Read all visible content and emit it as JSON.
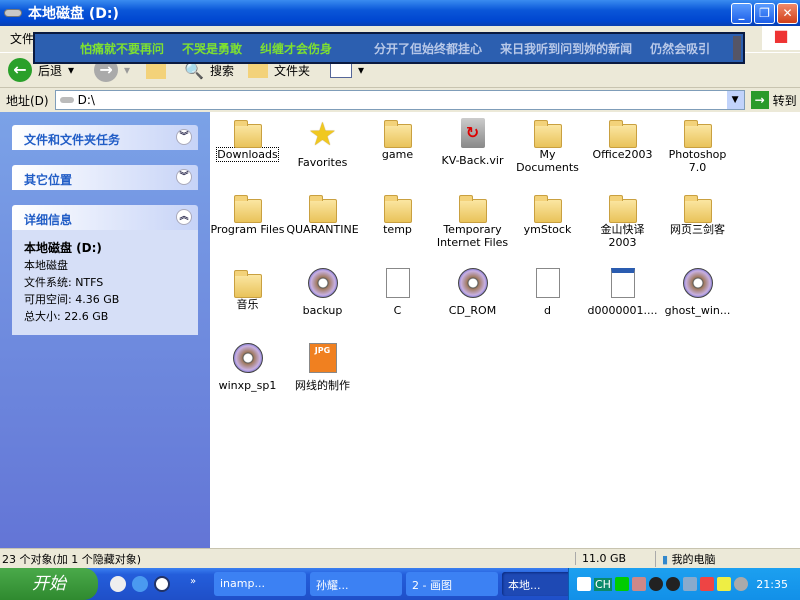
{
  "window": {
    "title": "本地磁盘 (D:)",
    "min": "_",
    "max": "❐",
    "close": "✕"
  },
  "menu": {
    "file": "文件"
  },
  "lyrics": {
    "line1": "怕痛就不要再问",
    "line2": "不哭是勇敢",
    "line3": "纠缠才会伤身",
    "line4": "分开了但始终都挂心",
    "line5": "来日我听到问到妳的新闻",
    "line6": "仍然会吸引"
  },
  "toolbar": {
    "back": "后退",
    "search": "搜索",
    "folders": "文件夹"
  },
  "address": {
    "label": "地址(D)",
    "value": "D:\\",
    "go": "转到"
  },
  "sidebar": {
    "tasks": "文件和文件夹任务",
    "other": "其它位置",
    "details": "详细信息",
    "drive_name": "本地磁盘 (D:)",
    "drive_type": "本地磁盘",
    "fs": "文件系统: NTFS",
    "free": "可用空间: 4.36 GB",
    "total": "总大小: 22.6 GB"
  },
  "files": [
    {
      "name": "Downloads",
      "type": "folder"
    },
    {
      "name": "Favorites",
      "type": "star"
    },
    {
      "name": "game",
      "type": "folder"
    },
    {
      "name": "KV-Back.vir",
      "type": "bin"
    },
    {
      "name": "My Documents",
      "type": "folder"
    },
    {
      "name": "Office2003",
      "type": "folder"
    },
    {
      "name": "Photoshop 7.0",
      "type": "folder"
    },
    {
      "name": "Program Files",
      "type": "folder"
    },
    {
      "name": "QUARANTINE",
      "type": "folder"
    },
    {
      "name": "temp",
      "type": "folder"
    },
    {
      "name": "Temporary Internet Files",
      "type": "folder"
    },
    {
      "name": "ymStock",
      "type": "folder"
    },
    {
      "name": "金山快译 2003",
      "type": "folder"
    },
    {
      "name": "网页三剑客",
      "type": "folder"
    },
    {
      "name": "音乐",
      "type": "folder"
    },
    {
      "name": "backup",
      "type": "cd"
    },
    {
      "name": "C",
      "type": "doc"
    },
    {
      "name": "CD_ROM",
      "type": "cd"
    },
    {
      "name": "d",
      "type": "doc"
    },
    {
      "name": "d0000001....",
      "type": "win"
    },
    {
      "name": "ghost_win...",
      "type": "cd"
    },
    {
      "name": "winxp_sp1",
      "type": "cd"
    },
    {
      "name": "网线的制作",
      "type": "jpg"
    }
  ],
  "status": {
    "count": "23 个对象(加 1 个隐藏对象)",
    "size": "11.0 GB",
    "location": "我的电脑"
  },
  "taskbar": {
    "start": "开始",
    "tasks": [
      "inamp...",
      "孙耀...",
      "2 - 画图",
      "本地..."
    ],
    "tray_ch": "CH",
    "clock": "21:35"
  }
}
